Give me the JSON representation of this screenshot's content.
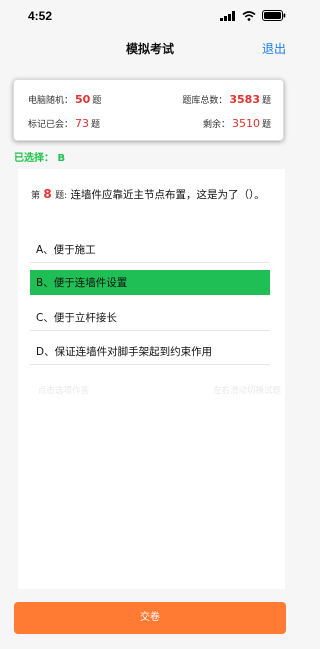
{
  "status_bar": {
    "time": "4:52"
  },
  "nav": {
    "title": "模拟考试",
    "exit_label": "退出"
  },
  "stats": {
    "random_label": "电脑随机：",
    "random_value": "50",
    "random_unit": "题",
    "total_label": "题库总数：",
    "total_value": "3583",
    "total_unit": "题",
    "marked_label": "标记已会：",
    "marked_value": "73",
    "marked_unit": "题",
    "remaining_label": "剩余：",
    "remaining_value": "3510",
    "remaining_unit": "题"
  },
  "selection": {
    "text": "已选择： B"
  },
  "question": {
    "prefix": "第",
    "number": "8",
    "suffix": "题:",
    "text": "连墙件应靠近主节点布置，这是为了（）。",
    "options": [
      {
        "label": "A、便于施工"
      },
      {
        "label": "B、便于连墙件设置"
      },
      {
        "label": "C、便于立杆接长"
      },
      {
        "label": "D、保证连墙件对脚手架起到约束作用"
      }
    ],
    "hint_left": "点击选项作答",
    "hint_right": "左右滑动切换试题"
  },
  "submit_label": "交卷",
  "colors": {
    "accent": "#1a7cf2",
    "highlight_value": "#e23333",
    "selected_option": "#1fbf55",
    "submit_button": "#ff7a33"
  }
}
